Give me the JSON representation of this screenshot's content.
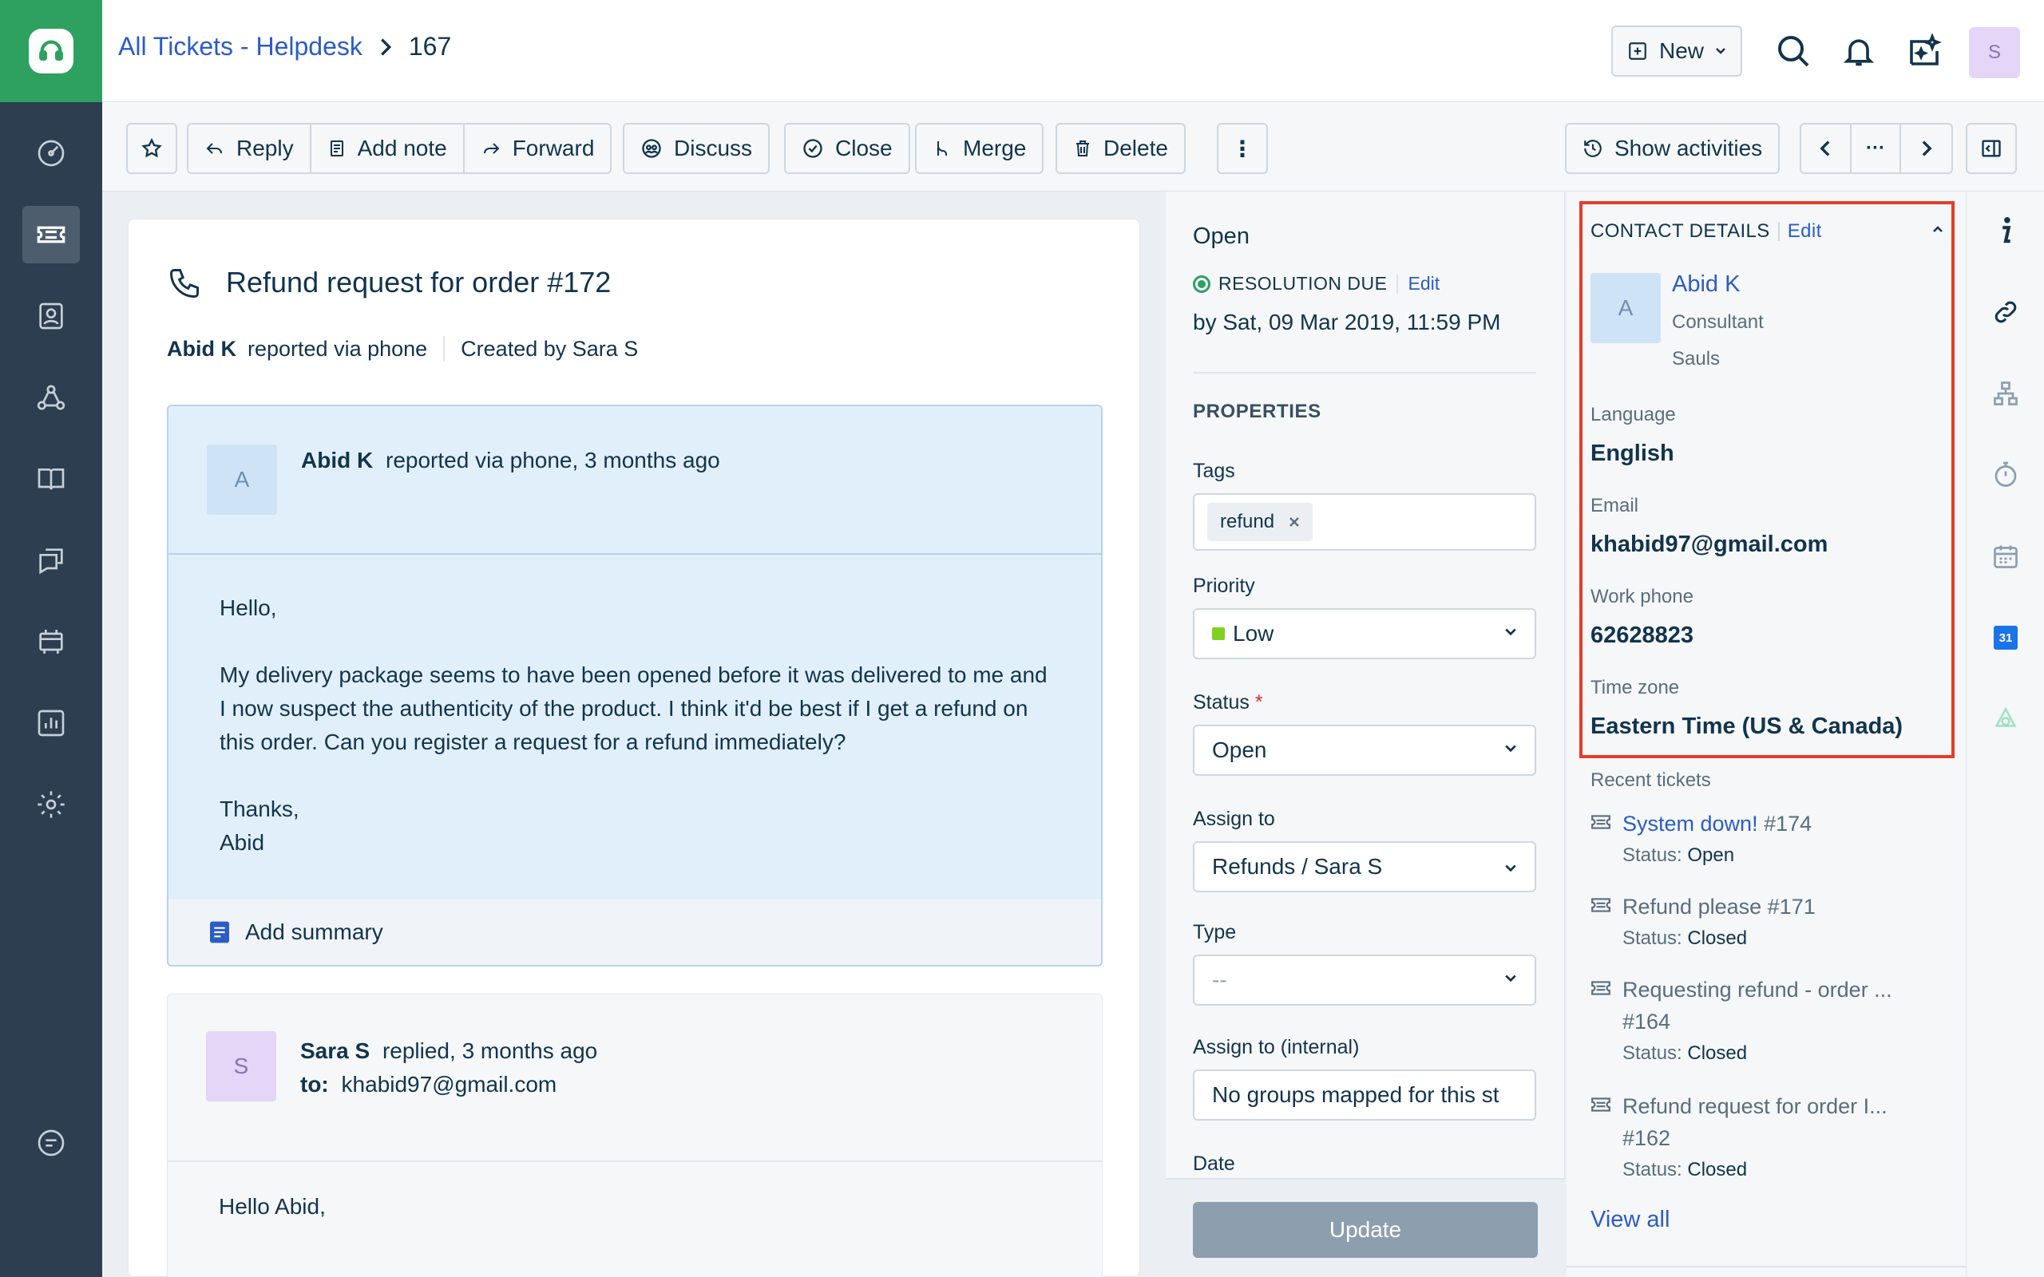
{
  "breadcrumb": {
    "link": "All Tickets - Helpdesk",
    "ticket_id": "167"
  },
  "header": {
    "new_label": "New",
    "user_initial": "S"
  },
  "toolbar": {
    "reply": "Reply",
    "add_note": "Add note",
    "forward": "Forward",
    "discuss": "Discuss",
    "close": "Close",
    "merge": "Merge",
    "delete": "Delete",
    "more": "⋮",
    "show_activities": "Show activities",
    "ellipsis": "···"
  },
  "ticket": {
    "title": "Refund request for order #172",
    "reporter_name": "Abid K",
    "reported_via": "reported via phone",
    "created_by": "Created by Sara S"
  },
  "message1": {
    "avatar": "A",
    "author": "Abid K",
    "meta": "reported via phone, 3 months ago",
    "greeting": "Hello,",
    "para1": "My delivery package seems to have been opened before it was delivered to me and I now suspect the authenticity of the product. I think it'd be best if I get a refund on this order. Can you register a request for a refund immediately?",
    "signoff": "Thanks,",
    "signature": "Abid",
    "summary_label": "Add summary"
  },
  "message2": {
    "avatar": "S",
    "author": "Sara S",
    "meta": "replied, 3 months ago",
    "to_label": "to:",
    "to_value": "khabid97@gmail.com",
    "greeting": "Hello Abid,"
  },
  "properties": {
    "status_heading": "Open",
    "resolution_label": "RESOLUTION DUE",
    "edit": "Edit",
    "due": "by Sat, 09 Mar 2019, 11:59 PM",
    "section": "PROPERTIES",
    "tags_label": "Tags",
    "tag": "refund",
    "priority_label": "Priority",
    "priority": "Low",
    "status_label": "Status",
    "required_mark": "*",
    "status": "Open",
    "assign_label": "Assign to",
    "assign": "Refunds / Sara S",
    "type_label": "Type",
    "type": "--",
    "internal_label": "Assign to (internal)",
    "internal": "No groups mapped for this st",
    "date_label": "Date",
    "update": "Update"
  },
  "contact": {
    "heading": "CONTACT DETAILS",
    "edit": "Edit",
    "avatar": "A",
    "name": "Abid K",
    "role": "Consultant",
    "company": "Sauls",
    "language_label": "Language",
    "language": "English",
    "email_label": "Email",
    "email": "khabid97@gmail.com",
    "phone_label": "Work phone",
    "phone": "62628823",
    "tz_label": "Time zone",
    "tz": "Eastern Time (US & Canada)",
    "recent_label": "Recent tickets",
    "recent": [
      {
        "title": "System down!",
        "num": "#174",
        "status": "Open"
      },
      {
        "title": "Refund please",
        "num": "#171",
        "status": "Closed"
      },
      {
        "title": "Requesting refund - order ...",
        "num": "#164",
        "status": "Closed"
      },
      {
        "title": "Refund request for order I...",
        "num": "#162",
        "status": "Closed"
      }
    ],
    "status_prefix": "Status:",
    "view_all": "View all"
  },
  "rail": {
    "calendar_day": "31"
  },
  "colors": {
    "brand_green": "#2ea05f",
    "nav_dark": "#2c3e50",
    "link_blue": "#2c5cc5",
    "highlight_red": "#e43e2b",
    "priority_low": "#7ed321"
  }
}
